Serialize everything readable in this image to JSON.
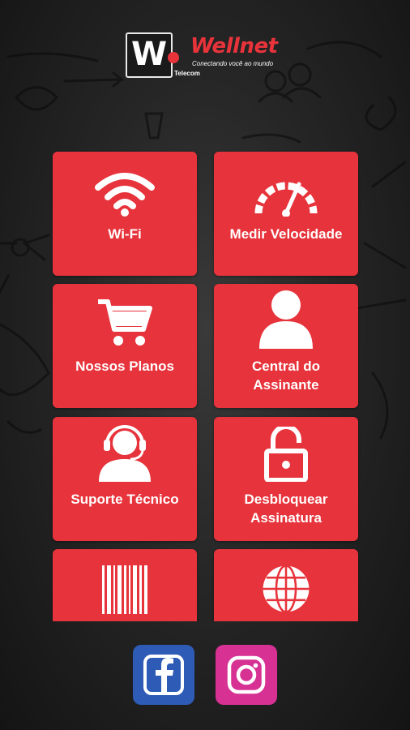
{
  "brand": {
    "logo_letter": "W",
    "name": "Wellnet",
    "tagline": "Conectando você ao mundo",
    "subtitle": "Telecom"
  },
  "tiles": [
    {
      "label": "Wi-Fi",
      "icon": "wifi-icon"
    },
    {
      "label": "Medir Velocidade",
      "icon": "speedometer-icon"
    },
    {
      "label": "Nossos Planos",
      "icon": "shopping-cart-icon"
    },
    {
      "label": "Central do Assinante",
      "icon": "user-icon"
    },
    {
      "label": "Suporte Técnico",
      "icon": "headset-support-icon"
    },
    {
      "label": "Desbloquear Assinatura",
      "icon": "unlock-icon"
    },
    {
      "label": "",
      "icon": "barcode-icon"
    },
    {
      "label": "",
      "icon": "globe-icon"
    }
  ],
  "social": [
    {
      "icon": "facebook-icon",
      "color": "#2d5bb5"
    },
    {
      "icon": "instagram-icon",
      "color": "#d63193"
    }
  ],
  "colors": {
    "accent": "#e7333b",
    "background": "#1b1b1b"
  }
}
